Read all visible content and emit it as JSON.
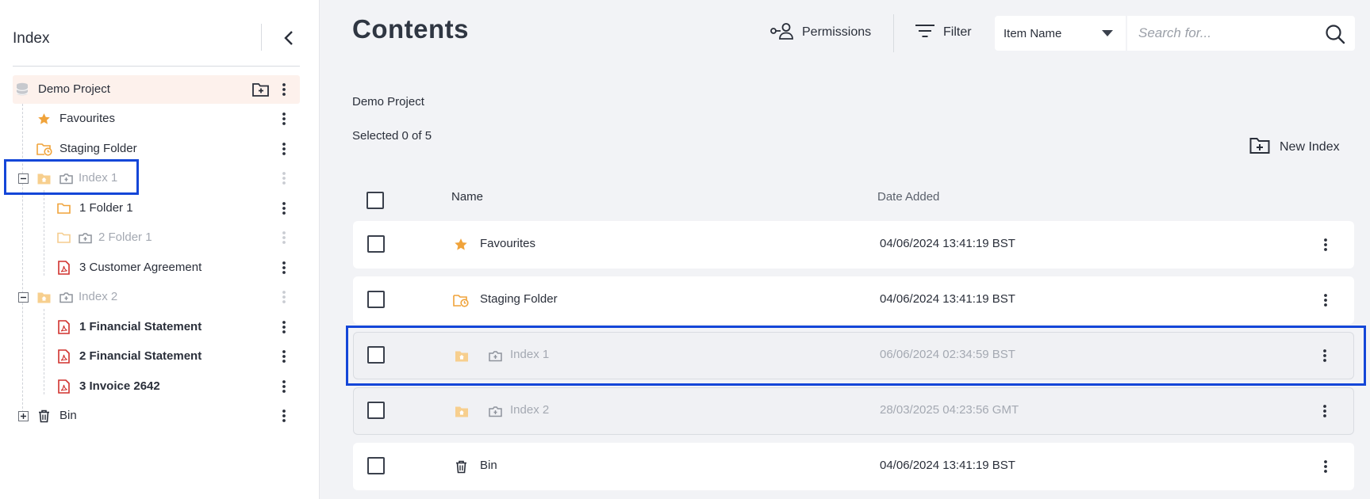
{
  "colors": {
    "accent_orange": "#f0a33a",
    "pdf_red": "#d0312d",
    "highlight_blue": "#1446d8",
    "root_bg": "#fdf1ec",
    "main_bg": "#f2f3f6"
  },
  "sidebar": {
    "title": "Index",
    "collapse_icon": "chevron-left-icon",
    "tree": [
      {
        "label": "Demo Project",
        "icon": "database-icon",
        "extra_icon": "folder-plus-icon"
      },
      {
        "label": "Favourites",
        "icon": "star-icon"
      },
      {
        "label": "Staging Folder",
        "icon": "folder-clock-icon"
      },
      {
        "label": "Index 1",
        "icon": "folder-home-icon",
        "extra_icon": "index-icon",
        "expander": "minus"
      },
      {
        "label": "1 Folder 1",
        "icon": "folder-icon"
      },
      {
        "label": "2 Folder 1",
        "icon": "folder-icon",
        "extra_icon": "index-icon"
      },
      {
        "label": "3 Customer Agreement",
        "icon": "pdf-icon"
      },
      {
        "label": "Index 2",
        "icon": "folder-home-icon",
        "extra_icon": "index-icon",
        "expander": "minus"
      },
      {
        "label": "1 Financial Statement",
        "icon": "pdf-icon"
      },
      {
        "label": "2 Financial Statement",
        "icon": "pdf-icon"
      },
      {
        "label": "3 Invoice 2642",
        "icon": "pdf-icon"
      },
      {
        "label": "Bin",
        "icon": "trash-icon",
        "expander": "plus"
      }
    ]
  },
  "main": {
    "title": "Contents",
    "toolbar": {
      "permissions_label": "Permissions",
      "filter_label": "Filter",
      "sort_select_value": "Item Name",
      "search_placeholder": "Search for..."
    },
    "breadcrumb": "Demo Project",
    "selected_text": "Selected 0 of 5",
    "new_index_label": "New Index",
    "columns": {
      "name": "Name",
      "date": "Date Added"
    },
    "rows": [
      {
        "name": "Favourites",
        "date": "04/06/2024 13:41:19 BST",
        "icon": "star-icon"
      },
      {
        "name": "Staging Folder",
        "date": "04/06/2024 13:41:19 BST",
        "icon": "folder-clock-icon"
      },
      {
        "name": "Index 1",
        "date": "06/06/2024 02:34:59 BST",
        "icon": "folder-home-icon",
        "extra_icon": "index-icon"
      },
      {
        "name": "Index 2",
        "date": "28/03/2025 04:23:56 GMT",
        "icon": "folder-home-icon",
        "extra_icon": "index-icon"
      },
      {
        "name": "Bin",
        "date": "04/06/2024 13:41:19 BST",
        "icon": "trash-icon"
      }
    ]
  }
}
